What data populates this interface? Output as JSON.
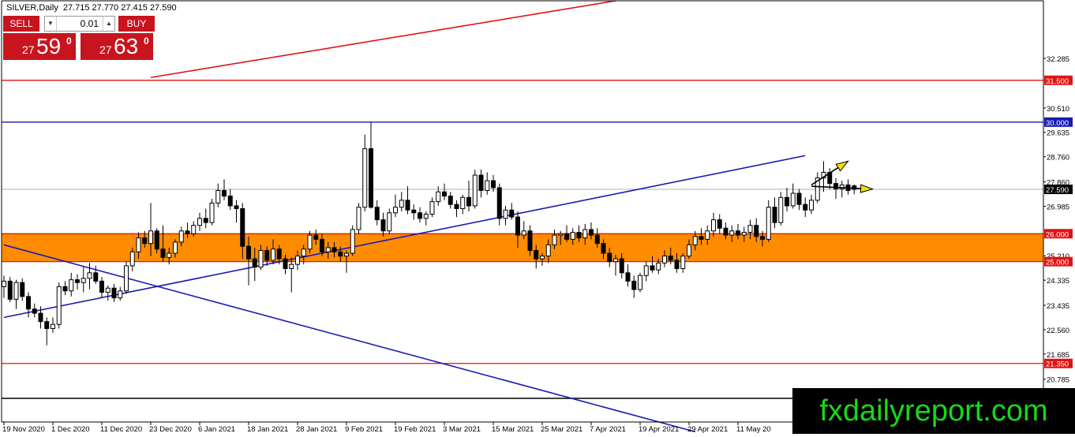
{
  "header": {
    "symbol": "SILVER,Daily",
    "ohlc": "27.715 27.770 27.415 27.590"
  },
  "trade_panel": {
    "sell_label": "SELL",
    "buy_label": "BUY",
    "lot_value": "0.01",
    "sell_price": {
      "prefix": "27",
      "big": "59",
      "sup": "0"
    },
    "buy_price": {
      "prefix": "27",
      "big": "63",
      "sup": "0"
    }
  },
  "watermark": "fxdailyreport.com",
  "colors": {
    "bull_candle": "#ffffff",
    "bear_candle": "#000000",
    "trendline": "#1a1ab4",
    "resistance": "#e01414",
    "zone": "#ff8c00",
    "price_label": "#e01414",
    "blue_label": "#1a1ab4",
    "arrow": "#f0e000"
  },
  "chart_data": {
    "type": "candlestick",
    "axis": {
      "ymin": 19.25,
      "ymax": 34.35,
      "grid": false,
      "scale": "linear"
    },
    "y_ticks": [
      "32.285",
      "31.500",
      "30.510",
      "30.000",
      "29.635",
      "28.760",
      "27.860",
      "27.590",
      "26.985",
      "26.000",
      "25.210",
      "25.000",
      "24.335",
      "23.435",
      "22.560",
      "21.685",
      "21.350",
      "20.785"
    ],
    "x_labels": [
      "19 Nov 2020",
      "1 Dec 2020",
      "11 Dec 2020",
      "23 Dec 2020",
      "6 Jan 2021",
      "18 Jan 2021",
      "28 Jan 2021",
      "9 Feb 2021",
      "19 Feb 2021",
      "3 Mar 2021",
      "15 Mar 2021",
      "25 Mar 2021",
      "7 Apr 2021",
      "19 Apr 2021",
      "29 Apr 2021",
      "11 May 20"
    ],
    "label_step": 8,
    "last_price": 27.59,
    "horizontal_lines": [
      {
        "value": 31.5,
        "label": "31.500",
        "color": "#e01414"
      },
      {
        "value": 30.0,
        "label": "30.000",
        "color": "#1a1ab4"
      },
      {
        "value": 26.0,
        "label": "26.000",
        "color": "#e01414"
      },
      {
        "value": 25.0,
        "label": "25.000",
        "color": "#e01414"
      },
      {
        "value": 21.35,
        "label": "21.350",
        "color": "#e01414"
      },
      {
        "value": 20.1,
        "label": "",
        "color": "#000000"
      }
    ],
    "zone": {
      "from": 25.0,
      "to": 26.0
    },
    "trendlines": [
      {
        "start": {
          "bar": 0,
          "price": 23.0
        },
        "end": {
          "bar": 131,
          "price": 28.8
        },
        "color": "#1a1ab4"
      },
      {
        "start": {
          "bar": 0,
          "price": 25.6
        },
        "end": {
          "bar": 113,
          "price": 18.9
        },
        "color": "#1a1ab4"
      },
      {
        "start": {
          "bar": 24,
          "price": 31.6
        },
        "end": {
          "bar": 100,
          "price": 34.35
        },
        "color": "#e01414"
      }
    ],
    "arrows": [
      {
        "start": {
          "bar": 132,
          "price": 27.75
        },
        "end": {
          "bar": 138,
          "price": 28.6
        }
      },
      {
        "start": {
          "bar": 132,
          "price": 27.7
        },
        "end": {
          "bar": 142,
          "price": 27.6
        }
      }
    ],
    "ohlc": [
      [
        24.1,
        24.5,
        23.7,
        24.3
      ],
      [
        24.3,
        24.45,
        23.55,
        23.65
      ],
      [
        23.65,
        24.35,
        23.3,
        24.25
      ],
      [
        24.25,
        24.4,
        23.6,
        23.75
      ],
      [
        23.75,
        23.9,
        23.0,
        23.3
      ],
      [
        23.3,
        23.5,
        23.0,
        23.15
      ],
      [
        23.15,
        23.4,
        22.6,
        22.85
      ],
      [
        22.85,
        23.0,
        22.0,
        22.6
      ],
      [
        22.6,
        23.0,
        22.45,
        22.75
      ],
      [
        22.75,
        24.25,
        22.6,
        24.1
      ],
      [
        24.1,
        24.3,
        23.8,
        23.95
      ],
      [
        23.95,
        24.6,
        23.75,
        24.35
      ],
      [
        24.35,
        24.55,
        24.0,
        24.25
      ],
      [
        24.25,
        24.8,
        23.9,
        24.4
      ],
      [
        24.4,
        24.95,
        24.0,
        24.6
      ],
      [
        24.6,
        24.85,
        24.2,
        24.3
      ],
      [
        24.3,
        24.45,
        23.7,
        23.9
      ],
      [
        23.9,
        24.15,
        23.6,
        24.05
      ],
      [
        24.05,
        24.2,
        23.55,
        23.7
      ],
      [
        23.7,
        24.1,
        23.6,
        23.95
      ],
      [
        23.95,
        25.0,
        23.85,
        24.85
      ],
      [
        24.85,
        25.5,
        24.65,
        25.35
      ],
      [
        25.35,
        26.05,
        25.1,
        25.85
      ],
      [
        25.85,
        26.1,
        25.5,
        25.65
      ],
      [
        25.65,
        27.1,
        25.2,
        26.1
      ],
      [
        26.1,
        26.2,
        25.3,
        25.45
      ],
      [
        25.45,
        26.3,
        25.0,
        25.15
      ],
      [
        25.15,
        25.5,
        24.9,
        25.3
      ],
      [
        25.3,
        25.8,
        25.15,
        25.7
      ],
      [
        25.7,
        26.25,
        25.55,
        26.1
      ],
      [
        26.1,
        26.4,
        25.85,
        26.0
      ],
      [
        26.0,
        26.45,
        25.9,
        26.3
      ],
      [
        26.3,
        26.75,
        26.1,
        26.55
      ],
      [
        26.55,
        26.9,
        26.2,
        26.4
      ],
      [
        26.4,
        27.25,
        26.3,
        27.1
      ],
      [
        27.1,
        27.8,
        26.95,
        27.55
      ],
      [
        27.55,
        27.95,
        27.2,
        27.35
      ],
      [
        27.35,
        27.6,
        26.85,
        27.0
      ],
      [
        27.0,
        27.2,
        26.4,
        26.9
      ],
      [
        26.9,
        27.1,
        25.1,
        25.55
      ],
      [
        25.55,
        25.9,
        24.15,
        25.1
      ],
      [
        25.1,
        25.5,
        24.3,
        24.8
      ],
      [
        24.8,
        25.6,
        24.7,
        25.4
      ],
      [
        25.4,
        25.55,
        24.85,
        25.05
      ],
      [
        25.05,
        25.8,
        24.9,
        25.45
      ],
      [
        25.45,
        25.6,
        24.9,
        25.1
      ],
      [
        25.1,
        25.25,
        24.55,
        24.75
      ],
      [
        24.75,
        25.15,
        23.9,
        24.9
      ],
      [
        24.9,
        25.4,
        24.7,
        25.2
      ],
      [
        25.2,
        25.6,
        24.9,
        25.45
      ],
      [
        25.45,
        26.1,
        25.3,
        25.95
      ],
      [
        25.95,
        26.15,
        25.6,
        25.8
      ],
      [
        25.8,
        26.0,
        25.2,
        25.35
      ],
      [
        25.35,
        25.7,
        25.1,
        25.5
      ],
      [
        25.5,
        25.7,
        25.15,
        25.35
      ],
      [
        25.35,
        25.55,
        25.0,
        25.2
      ],
      [
        25.2,
        25.4,
        24.6,
        25.3
      ],
      [
        25.3,
        26.3,
        25.2,
        26.15
      ],
      [
        26.15,
        27.1,
        26.0,
        26.95
      ],
      [
        26.95,
        29.55,
        26.8,
        29.05
      ],
      [
        29.05,
        30.0,
        26.9,
        26.95
      ],
      [
        26.95,
        27.2,
        26.3,
        26.5
      ],
      [
        26.5,
        26.75,
        25.9,
        26.1
      ],
      [
        26.1,
        26.9,
        26.0,
        26.75
      ],
      [
        26.75,
        27.4,
        26.6,
        26.95
      ],
      [
        26.95,
        27.5,
        26.8,
        27.2
      ],
      [
        27.2,
        27.7,
        26.7,
        26.85
      ],
      [
        26.85,
        27.05,
        26.5,
        26.75
      ],
      [
        26.75,
        26.95,
        26.4,
        26.55
      ],
      [
        26.55,
        26.8,
        26.3,
        26.7
      ],
      [
        26.7,
        27.3,
        26.6,
        27.15
      ],
      [
        27.15,
        27.7,
        27.0,
        27.5
      ],
      [
        27.5,
        27.8,
        27.2,
        27.35
      ],
      [
        27.35,
        27.5,
        26.9,
        27.05
      ],
      [
        27.05,
        27.2,
        26.6,
        26.9
      ],
      [
        26.9,
        27.4,
        26.7,
        27.3
      ],
      [
        27.3,
        27.9,
        26.8,
        27.0
      ],
      [
        27.0,
        28.3,
        26.9,
        28.1
      ],
      [
        28.1,
        28.3,
        27.3,
        27.55
      ],
      [
        27.55,
        28.2,
        27.4,
        27.9
      ],
      [
        27.9,
        28.1,
        27.5,
        27.65
      ],
      [
        27.65,
        27.8,
        26.3,
        26.55
      ],
      [
        26.55,
        27.0,
        26.3,
        26.85
      ],
      [
        26.85,
        27.1,
        26.5,
        26.6
      ],
      [
        26.6,
        26.8,
        25.5,
        25.95
      ],
      [
        25.95,
        26.45,
        25.8,
        26.1
      ],
      [
        26.1,
        26.3,
        25.2,
        25.4
      ],
      [
        25.4,
        25.6,
        24.75,
        25.1
      ],
      [
        25.1,
        25.3,
        24.85,
        25.2
      ],
      [
        25.2,
        25.8,
        24.95,
        25.6
      ],
      [
        25.6,
        26.15,
        25.45,
        25.95
      ],
      [
        25.95,
        26.1,
        25.6,
        26.0
      ],
      [
        26.0,
        26.3,
        25.7,
        25.8
      ],
      [
        25.8,
        26.2,
        25.6,
        26.05
      ],
      [
        26.05,
        26.3,
        25.7,
        25.85
      ],
      [
        25.85,
        26.35,
        25.6,
        26.15
      ],
      [
        26.15,
        26.4,
        25.8,
        25.95
      ],
      [
        25.95,
        26.2,
        25.5,
        25.65
      ],
      [
        25.65,
        25.8,
        25.1,
        25.3
      ],
      [
        25.3,
        25.5,
        24.8,
        25.0
      ],
      [
        25.0,
        25.25,
        24.5,
        25.1
      ],
      [
        25.1,
        25.3,
        24.4,
        24.6
      ],
      [
        24.6,
        24.9,
        24.1,
        24.3
      ],
      [
        24.3,
        24.5,
        23.7,
        24.0
      ],
      [
        24.0,
        24.6,
        23.9,
        24.5
      ],
      [
        24.5,
        25.0,
        24.3,
        24.85
      ],
      [
        24.85,
        25.2,
        24.6,
        24.7
      ],
      [
        24.7,
        25.1,
        24.55,
        24.95
      ],
      [
        24.95,
        25.4,
        24.8,
        25.2
      ],
      [
        25.2,
        25.5,
        24.9,
        25.05
      ],
      [
        25.05,
        25.3,
        24.6,
        24.75
      ],
      [
        24.75,
        25.3,
        24.6,
        25.2
      ],
      [
        25.2,
        25.8,
        25.1,
        25.6
      ],
      [
        25.6,
        26.1,
        25.4,
        25.9
      ],
      [
        25.9,
        26.2,
        25.6,
        25.8
      ],
      [
        25.8,
        26.3,
        25.6,
        26.1
      ],
      [
        26.1,
        26.75,
        25.9,
        26.5
      ],
      [
        26.5,
        26.7,
        26.0,
        26.2
      ],
      [
        26.2,
        26.4,
        25.8,
        25.95
      ],
      [
        25.95,
        26.3,
        25.7,
        26.1
      ],
      [
        26.1,
        26.35,
        25.8,
        25.95
      ],
      [
        25.95,
        26.25,
        25.7,
        26.05
      ],
      [
        26.05,
        26.5,
        25.8,
        26.3
      ],
      [
        26.3,
        26.55,
        25.7,
        25.9
      ],
      [
        25.9,
        26.1,
        25.55,
        25.8
      ],
      [
        25.8,
        27.2,
        25.7,
        26.95
      ],
      [
        26.95,
        27.3,
        26.2,
        26.4
      ],
      [
        26.4,
        27.5,
        26.3,
        27.3
      ],
      [
        27.3,
        27.65,
        26.8,
        27.0
      ],
      [
        27.0,
        27.8,
        26.9,
        27.45
      ],
      [
        27.45,
        27.6,
        26.85,
        27.05
      ],
      [
        27.05,
        27.3,
        26.6,
        26.85
      ],
      [
        26.85,
        27.4,
        26.7,
        27.2
      ],
      [
        27.2,
        28.2,
        27.1,
        28.0
      ],
      [
        28.0,
        28.6,
        27.5,
        28.2
      ],
      [
        28.2,
        28.35,
        27.6,
        27.8
      ],
      [
        27.8,
        28.0,
        27.25,
        27.6
      ],
      [
        27.6,
        27.9,
        27.3,
        27.75
      ],
      [
        27.75,
        27.95,
        27.4,
        27.55
      ],
      [
        27.715,
        27.77,
        27.415,
        27.59
      ]
    ]
  }
}
